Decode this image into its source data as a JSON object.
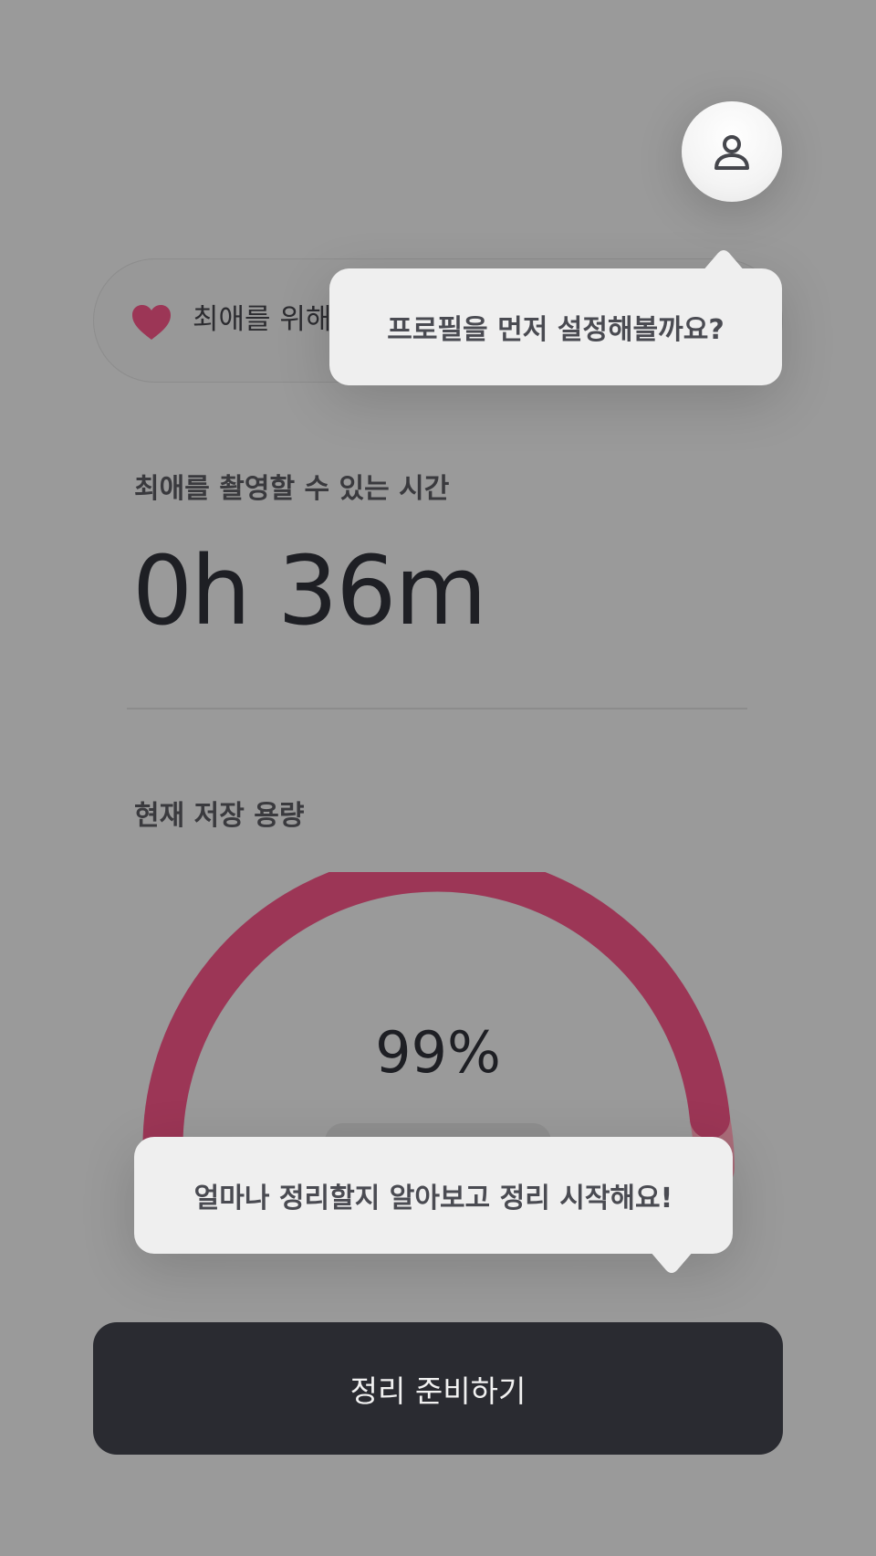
{
  "header": {
    "profile_icon": "user-icon"
  },
  "favorite_pill": {
    "icon": "heart-icon",
    "text": "최애를 위해"
  },
  "tooltips": {
    "profile": "프로필을 먼저 설정해볼까요?",
    "cleanup": "얼마나 정리할지 알아보고 정리 시작해요!"
  },
  "recording_time": {
    "label": "최애를 촬영할 수 있는 시간",
    "value": "0h 36m"
  },
  "storage": {
    "label": "현재 저장 용량",
    "percent_text": "99%",
    "percent": 99
  },
  "primary_button": {
    "label": "정리 준비하기"
  },
  "colors": {
    "accent": "#9c3656",
    "accent_light": "#b8475f",
    "dark_button": "#2a2b31",
    "tooltip_bg": "#efefef"
  }
}
